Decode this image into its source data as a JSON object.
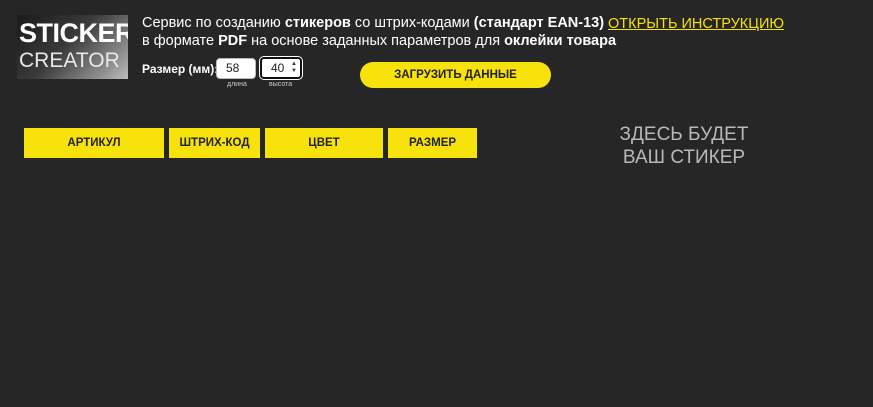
{
  "logo": {
    "line1": "STICKER",
    "line2": "CREATOR"
  },
  "description": {
    "l1_a": "Сервис по созданию ",
    "l1_b": "стикеров",
    "l1_c": " со штрих-кодами ",
    "l1_d": "(стандарт EAN-13)",
    "l2_a": "в формате ",
    "l2_b": "PDF",
    "l2_c": " на основе заданных параметров для ",
    "l2_d": "оклейки товара"
  },
  "instruction_link": "ОТКРЫТЬ ИНСТРУКЦИЮ",
  "size": {
    "label": "Размер (мм):",
    "length_value": "58",
    "height_value": "40",
    "length_caption": "длина",
    "height_caption": "высота"
  },
  "upload_button": "ЗАГРУЗИТЬ ДАННЫЕ",
  "columns": [
    "АРТИКУЛ",
    "ШТРИХ-КОД",
    "ЦВЕТ",
    "РАЗМЕР"
  ],
  "sticker_placeholder": {
    "line1": "ЗДЕСЬ БУДЕТ",
    "line2": "ВАШ СТИКЕР"
  },
  "colors": {
    "background": "#262626",
    "accent": "#f7e20b",
    "placeholder_text": "#b9b9b9"
  },
  "icons": {
    "spinner": "up-down-arrows-icon"
  }
}
